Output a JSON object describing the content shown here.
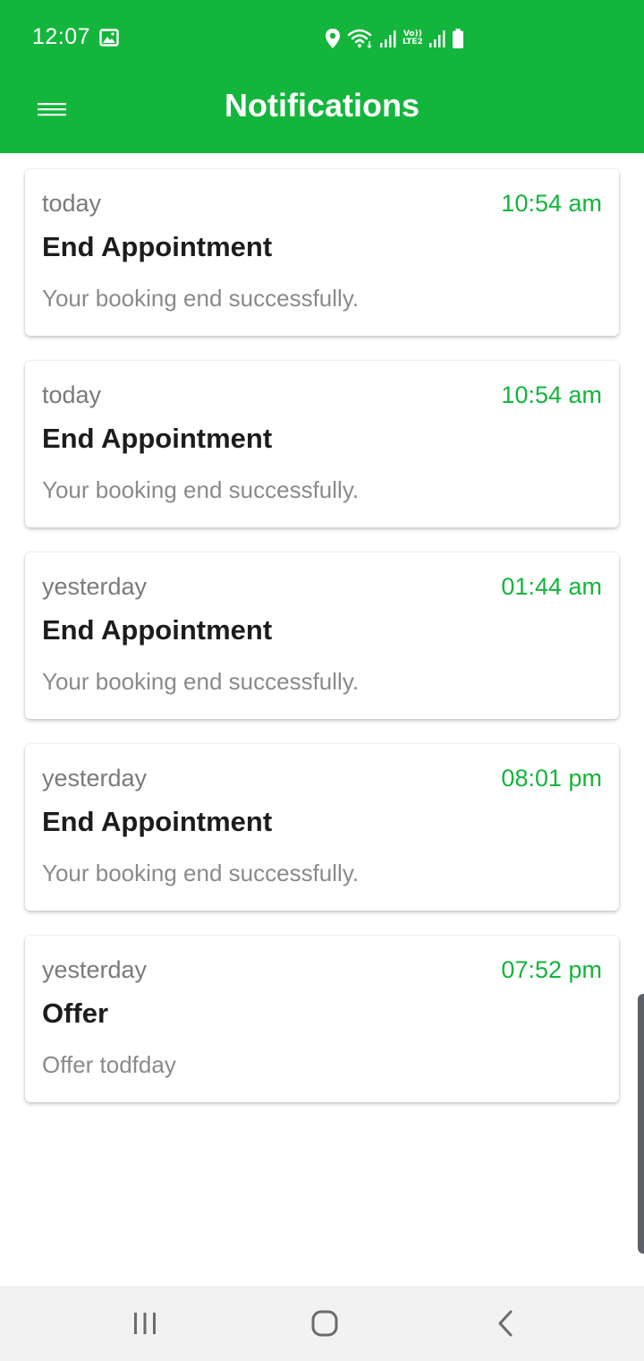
{
  "status_bar": {
    "time": "12:07",
    "network_label_top": "Vo))",
    "network_label_bottom": "LTE2",
    "icons": [
      "gallery-icon",
      "location-icon",
      "wifi-icon",
      "signal-icon",
      "signal-icon",
      "battery-icon"
    ]
  },
  "app_bar": {
    "title": "Notifications",
    "menu_icon": "hamburger-menu-icon"
  },
  "colors": {
    "primary": "#14b53c",
    "time_text": "#14b53c",
    "title_text": "#1c1c1c",
    "secondary_text": "#7a7a7a"
  },
  "notifications": [
    {
      "day": "today",
      "time": "10:54 am",
      "title": "End Appointment",
      "body": "Your booking end successfully."
    },
    {
      "day": "today",
      "time": "10:54 am",
      "title": "End Appointment",
      "body": "Your booking end successfully."
    },
    {
      "day": "yesterday",
      "time": "01:44 am",
      "title": "End Appointment",
      "body": "Your booking end successfully."
    },
    {
      "day": "yesterday",
      "time": "08:01 pm",
      "title": "End Appointment",
      "body": "Your booking end successfully."
    },
    {
      "day": "yesterday",
      "time": "07:52 pm",
      "title": "Offer",
      "body": "Offer  todfday"
    }
  ],
  "nav_bar": {
    "icons": [
      "recent-apps-icon",
      "home-icon",
      "back-icon"
    ]
  }
}
